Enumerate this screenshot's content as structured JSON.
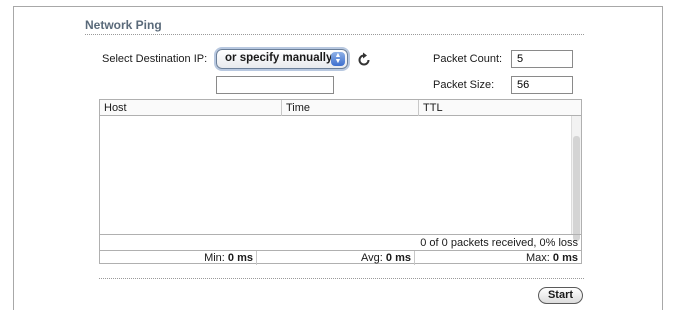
{
  "section": {
    "title": "Network Ping"
  },
  "destination": {
    "label": "Select Destination IP:",
    "select_value": "or specify manually",
    "manual_ip_value": ""
  },
  "packet_count": {
    "label": "Packet Count:",
    "value": "5"
  },
  "packet_size": {
    "label": "Packet Size:",
    "value": "56"
  },
  "icons": {
    "refresh": "refresh-icon",
    "select_arrows": "up-down-arrows-icon"
  },
  "table": {
    "columns": [
      "Host",
      "Time",
      "TTL"
    ],
    "rows": [],
    "summary": "0 of 0 packets received, 0% loss",
    "min_label": "Min:",
    "min_value": "0 ms",
    "avg_label": "Avg:",
    "avg_value": "0 ms",
    "max_label": "Max:",
    "max_value": "0 ms"
  },
  "actions": {
    "start_label": "Start"
  },
  "colors": {
    "title": "#5a6a7a",
    "select_accent": "#3d6fcf"
  }
}
